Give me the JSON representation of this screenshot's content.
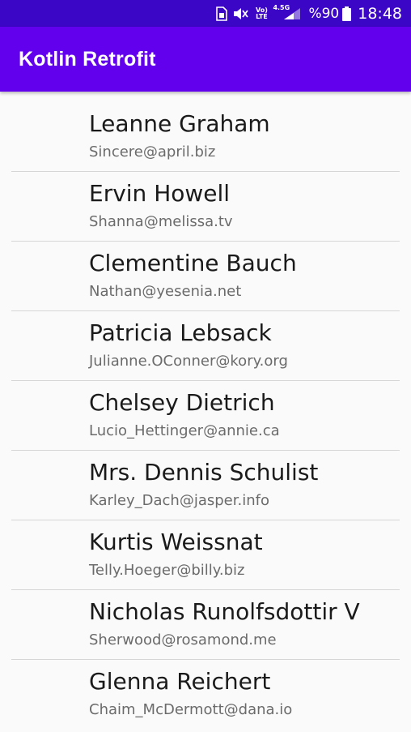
{
  "status_bar": {
    "lte_label": "Vo) LTE",
    "network_label": "4.5G",
    "battery": "%90",
    "time": "18:48",
    "icons": [
      "sim-icon",
      "mute-icon",
      "volte-icon",
      "signal-icon",
      "battery-icon"
    ]
  },
  "app_bar": {
    "title": "Kotlin Retrofit"
  },
  "users": [
    {
      "name": "Leanne Graham",
      "email": "Sincere@april.biz"
    },
    {
      "name": "Ervin Howell",
      "email": "Shanna@melissa.tv"
    },
    {
      "name": "Clementine Bauch",
      "email": "Nathan@yesenia.net"
    },
    {
      "name": "Patricia Lebsack",
      "email": "Julianne.OConner@kory.org"
    },
    {
      "name": "Chelsey Dietrich",
      "email": "Lucio_Hettinger@annie.ca"
    },
    {
      "name": "Mrs. Dennis Schulist",
      "email": "Karley_Dach@jasper.info"
    },
    {
      "name": "Kurtis Weissnat",
      "email": "Telly.Hoeger@billy.biz"
    },
    {
      "name": "Nicholas Runolfsdottir V",
      "email": "Sherwood@rosamond.me"
    },
    {
      "name": "Glenna Reichert",
      "email": "Chaim_McDermott@dana.io"
    }
  ],
  "colors": {
    "status_bar": "#3c06c6",
    "app_bar": "#6200ee",
    "background": "#fafafa",
    "divider": "#d6d6d6"
  }
}
